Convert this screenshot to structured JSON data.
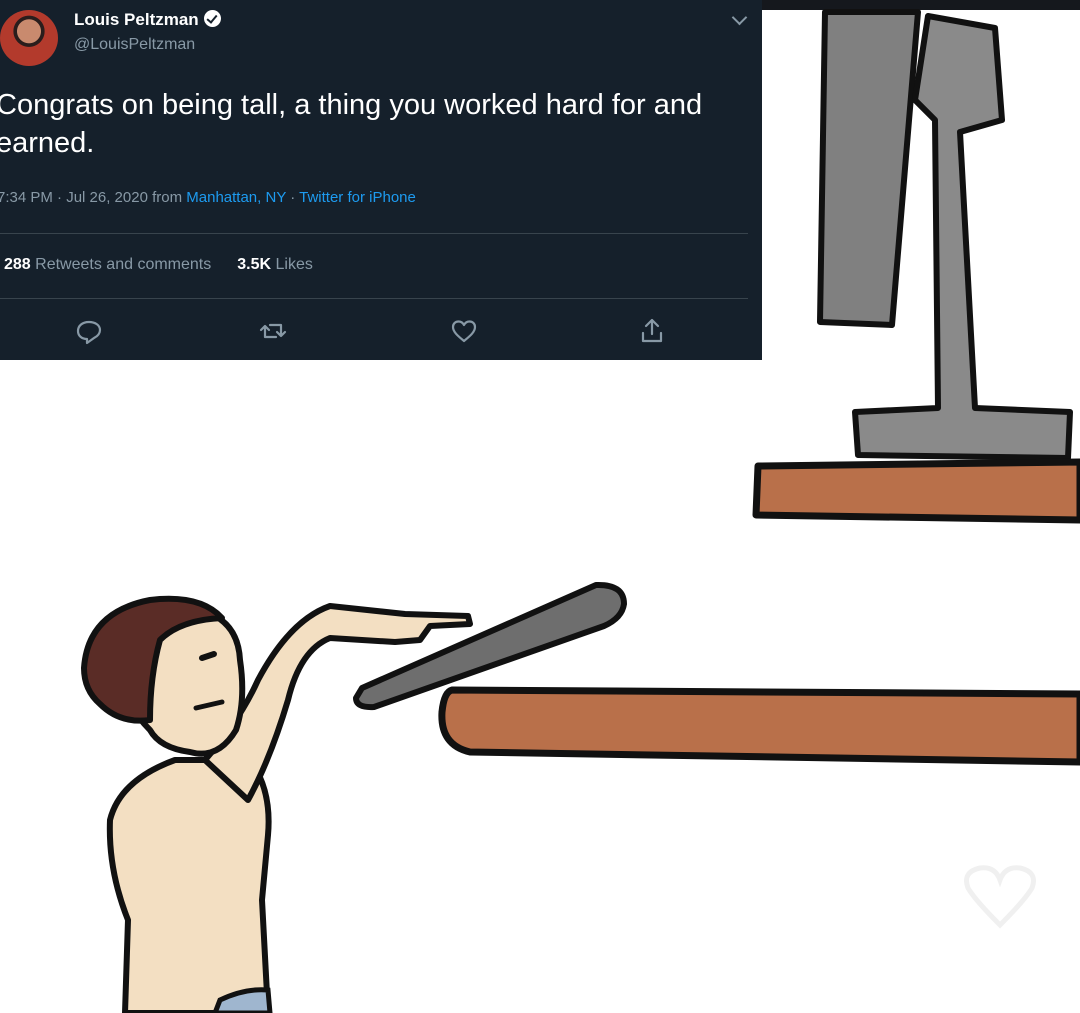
{
  "tweet": {
    "author_name": "Louis Peltzman",
    "author_handle": "@LouisPeltzman",
    "text": "Congrats on being tall, a thing you worked hard for and earned.",
    "time": "7:34 PM · Jul 26, 2020 from ",
    "location": "Manhattan, NY",
    "separator": " · ",
    "client": "Twitter for iPhone",
    "retweets_count": "288",
    "retweets_label": "Retweets and comments",
    "likes_count": "3.5K",
    "likes_label": "Likes"
  },
  "actions": {
    "reply_icon": "reply-icon",
    "retweet_icon": "retweet-icon",
    "like_icon": "heart-icon",
    "share_icon": "share-icon"
  },
  "colors": {
    "tweet_background": "#15202b",
    "link": "#1d9bf0",
    "shelf": "#b9704a",
    "controller": "#6e6e6e",
    "skin": "#f3dfc2",
    "hair": "#5a2c26"
  }
}
